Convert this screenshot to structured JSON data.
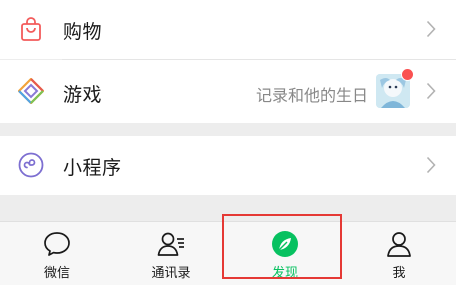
{
  "list": {
    "shop": {
      "label": "购物",
      "icon": "shopping-bag-icon"
    },
    "game": {
      "label": "游戏",
      "icon": "game-diamond-icon",
      "subtext": "记录和他的生日",
      "has_red_dot": true
    },
    "mini_program": {
      "label": "小程序",
      "icon": "mini-program-icon"
    }
  },
  "tabbar": {
    "tabs": [
      {
        "label": "微信",
        "icon": "chat-bubble-icon",
        "active": false
      },
      {
        "label": "通讯录",
        "icon": "contacts-icon",
        "active": false
      },
      {
        "label": "发现",
        "icon": "compass-icon",
        "active": true
      },
      {
        "label": "我",
        "icon": "person-icon",
        "active": false
      }
    ]
  },
  "colors": {
    "active_tab": "#07c160",
    "highlight_box": "#e53935",
    "red_dot": "#fa5151",
    "shop_icon": "#f35b5b",
    "mini_icon": "#7d6fd1"
  }
}
